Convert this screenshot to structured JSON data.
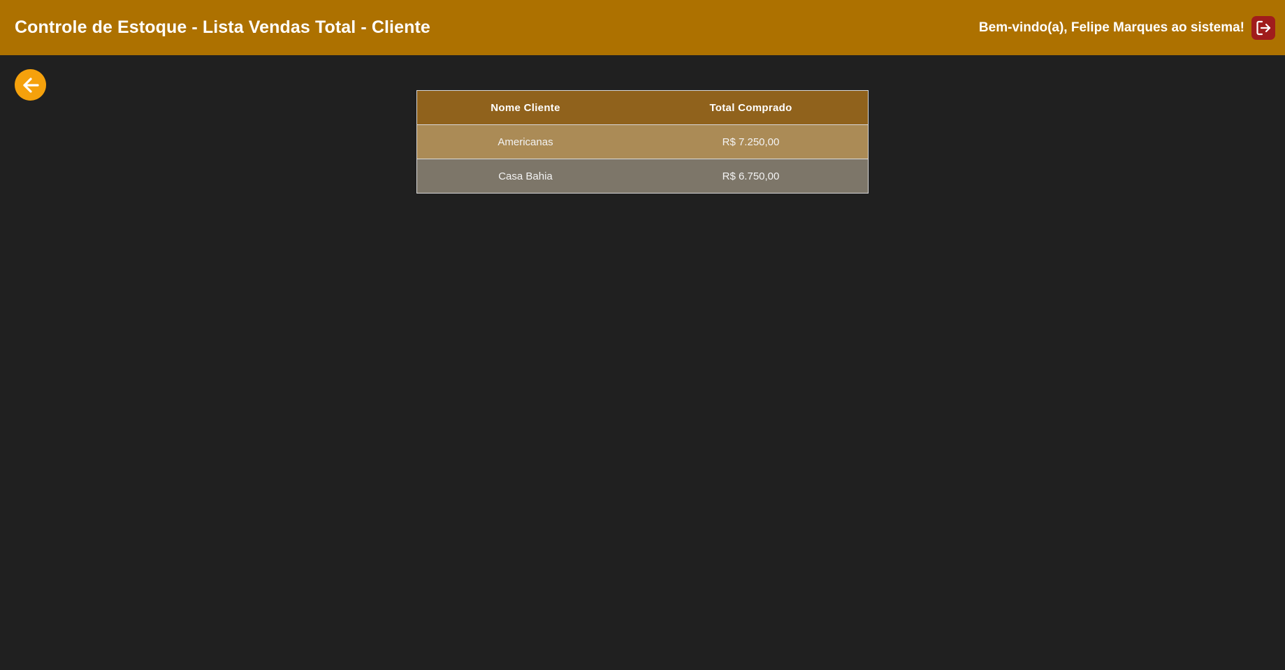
{
  "header": {
    "title": "Controle de Estoque - Lista Vendas Total - Cliente",
    "welcome": "Bem-vindo(a), Felipe Marques ao sistema!",
    "logout_icon": "logout-icon"
  },
  "back_button": {
    "icon": "arrow-left-icon"
  },
  "table": {
    "columns": [
      "Nome Cliente",
      "Total Comprado"
    ],
    "rows": [
      {
        "nome_cliente": "Americanas",
        "total_comprado": "R$ 7.250,00"
      },
      {
        "nome_cliente": "Casa Bahia",
        "total_comprado": "R$ 6.750,00"
      }
    ]
  },
  "colors": {
    "header_bg": "#ad7100",
    "page_bg": "#202020",
    "table_header_bg": "#90621c",
    "row_odd_bg": "#ab8b56",
    "row_even_bg": "#7d7669",
    "back_button_bg": "#f5a10c",
    "logout_button_bg": "#a01c1c"
  }
}
